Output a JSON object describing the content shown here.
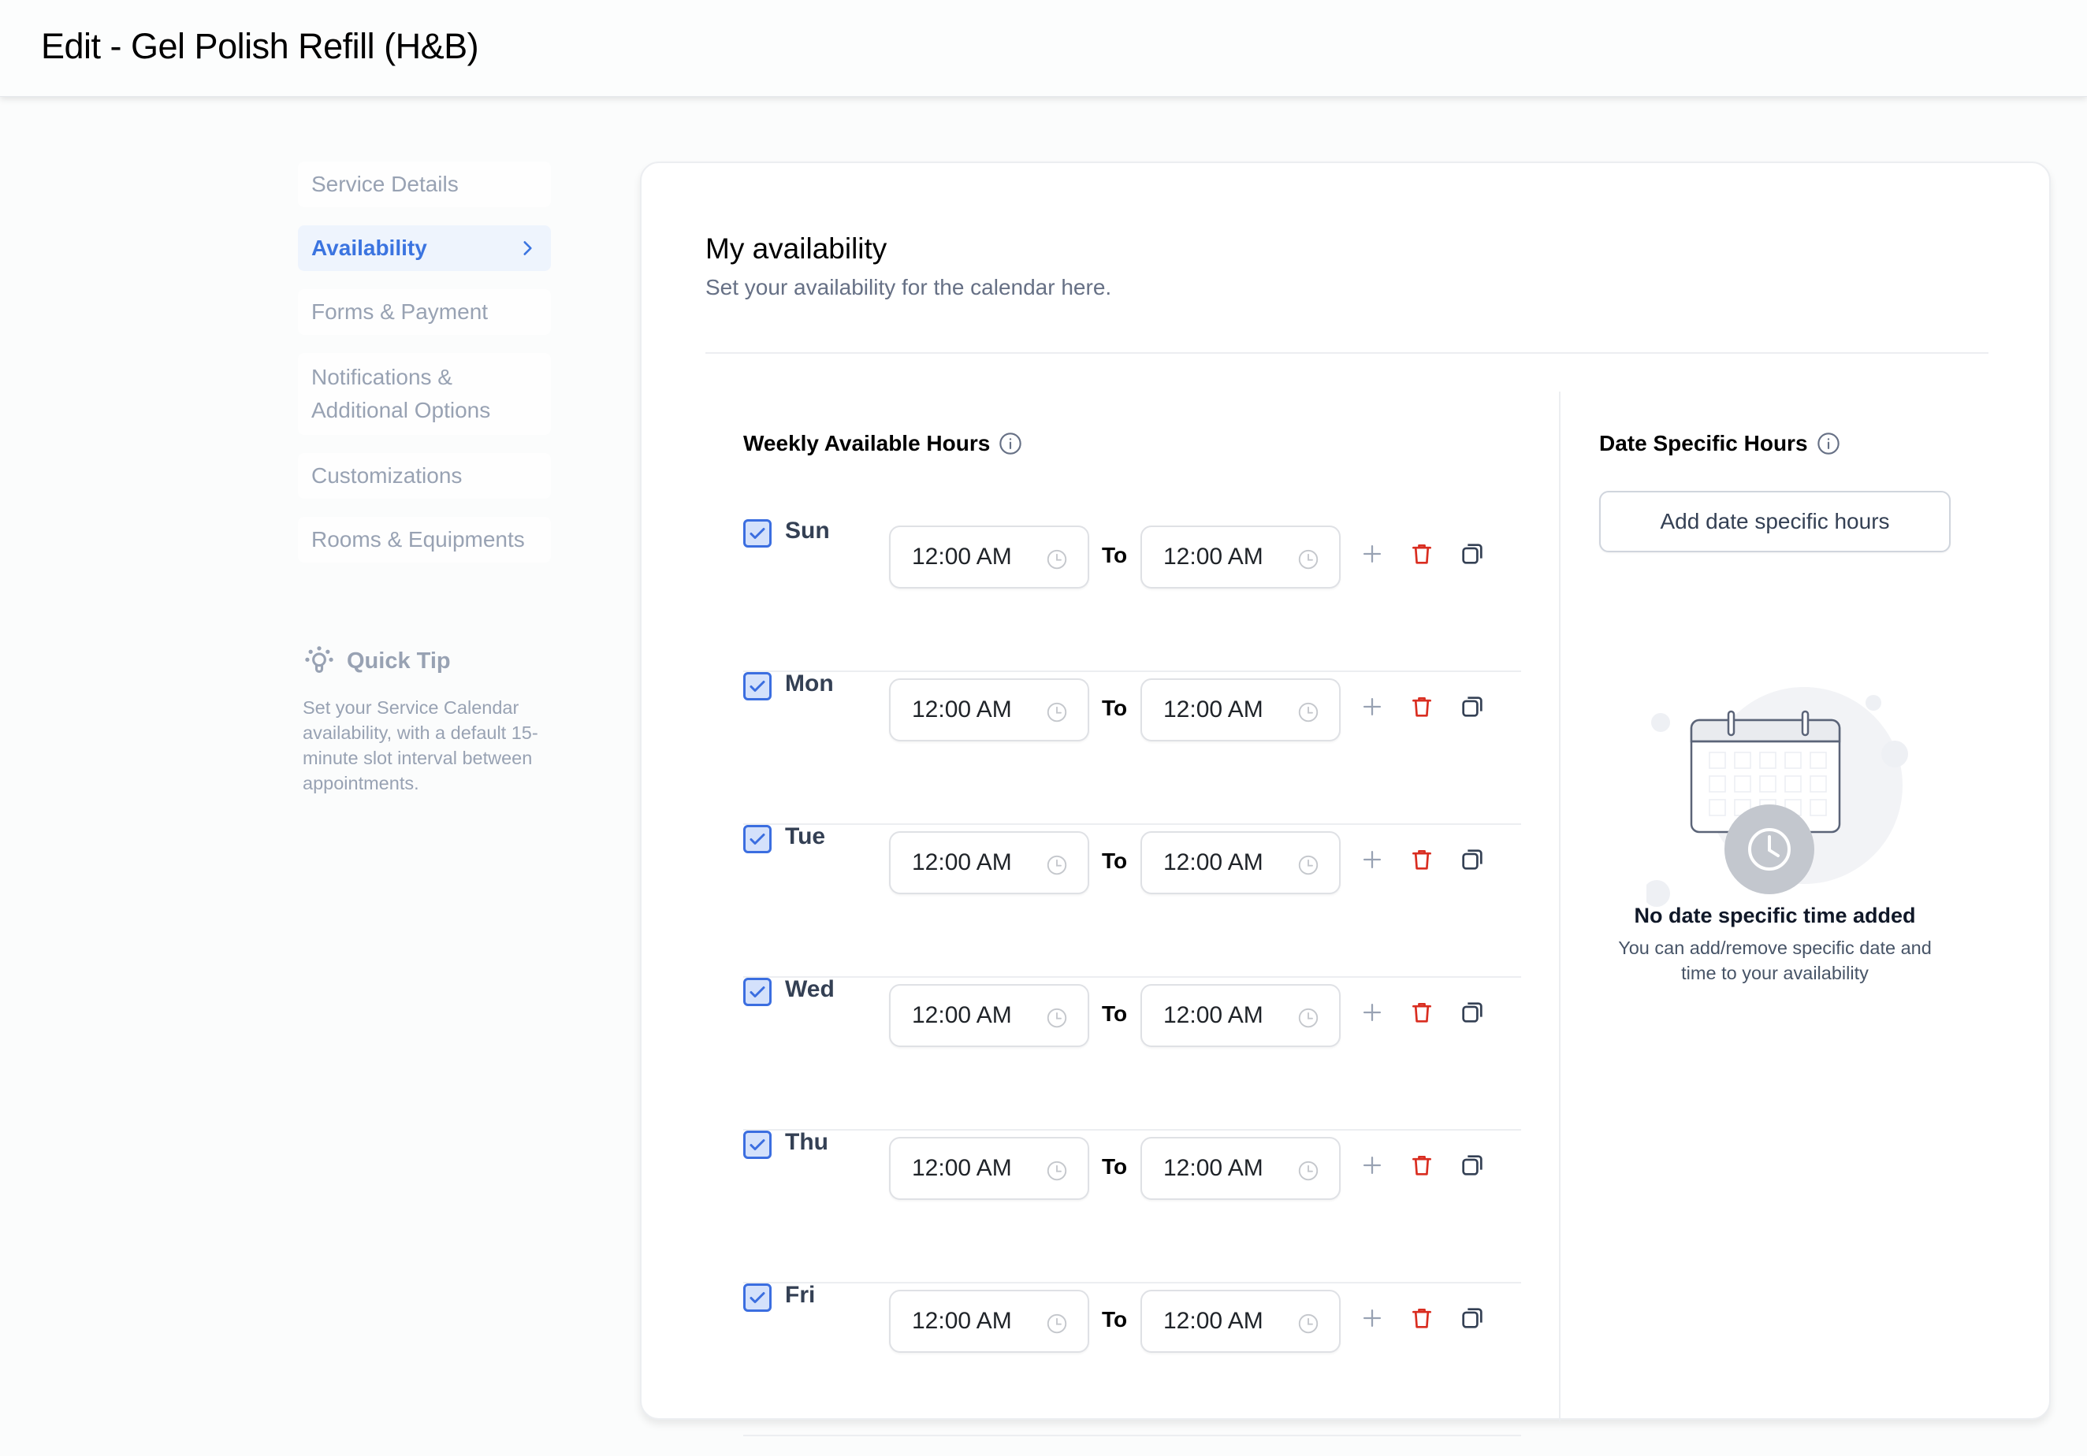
{
  "header": {
    "title": "Edit - Gel Polish Refill (H&B)"
  },
  "sidebar": {
    "items": [
      {
        "label": "Service Details",
        "active": false
      },
      {
        "label": "Availability",
        "active": true
      },
      {
        "label": "Forms & Payment",
        "active": false
      },
      {
        "label": "Notifications & Additional Options",
        "active": false
      },
      {
        "label": "Customizations",
        "active": false
      },
      {
        "label": "Rooms & Equipments",
        "active": false
      }
    ],
    "quick_tip": {
      "title": "Quick Tip",
      "icon": "lightbulb-icon",
      "text": "Set your Service Calendar availability, with a default 15-minute slot interval between appointments."
    }
  },
  "main": {
    "title": "My availability",
    "subtitle": "Set your availability for the calendar here.",
    "weekly": {
      "heading": "Weekly Available Hours",
      "to_label": "To",
      "days": [
        {
          "day": "Sun",
          "checked": true,
          "from": "12:00 AM",
          "to": "12:00 AM"
        },
        {
          "day": "Mon",
          "checked": true,
          "from": "12:00 AM",
          "to": "12:00 AM"
        },
        {
          "day": "Tue",
          "checked": true,
          "from": "12:00 AM",
          "to": "12:00 AM"
        },
        {
          "day": "Wed",
          "checked": true,
          "from": "12:00 AM",
          "to": "12:00 AM"
        },
        {
          "day": "Thu",
          "checked": true,
          "from": "12:00 AM",
          "to": "12:00 AM"
        },
        {
          "day": "Fri",
          "checked": true,
          "from": "12:00 AM",
          "to": "12:00 AM"
        }
      ]
    },
    "date_specific": {
      "heading": "Date Specific Hours",
      "add_button": "Add date specific hours",
      "empty_title": "No date specific time added",
      "empty_text": "You can add/remove specific date and time to your availability"
    }
  },
  "colors": {
    "accent": "#3b74e0",
    "delete": "#d92d20",
    "muted_text": "#98a2b3",
    "active_bg": "#eef4fd"
  }
}
